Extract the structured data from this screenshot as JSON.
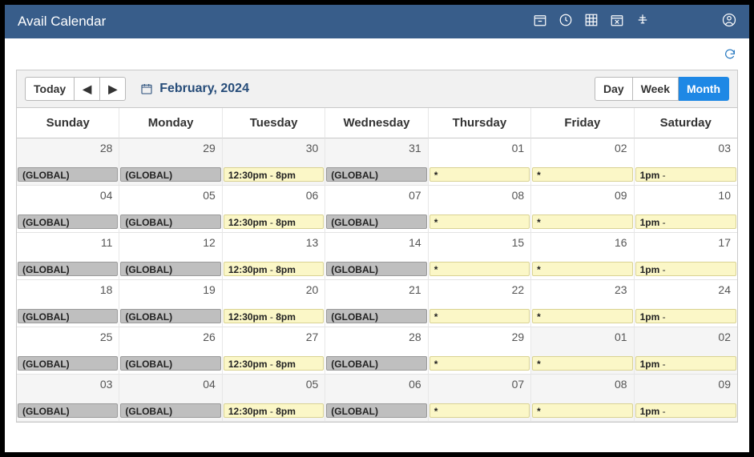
{
  "header": {
    "title": "Avail Calendar"
  },
  "toolbar": {
    "today": "Today",
    "prev": "◀",
    "next": "▶",
    "period": "February, 2024",
    "views": {
      "day": "Day",
      "week": "Week",
      "month": "Month",
      "active": "month"
    }
  },
  "day_names": [
    "Sunday",
    "Monday",
    "Tuesday",
    "Wednesday",
    "Thursday",
    "Friday",
    "Saturday"
  ],
  "events": {
    "global": "(GLOBAL)",
    "tuesday_from": "12:30pm",
    "tuesday_to": "8pm",
    "star": "*",
    "saturday_from": "1pm"
  },
  "weeks": [
    [
      {
        "num": "28",
        "out": true,
        "evt": "global"
      },
      {
        "num": "29",
        "out": true,
        "evt": "global"
      },
      {
        "num": "30",
        "out": true,
        "evt": "tuesday"
      },
      {
        "num": "31",
        "out": true,
        "evt": "global"
      },
      {
        "num": "01",
        "evt": "star"
      },
      {
        "num": "02",
        "evt": "star"
      },
      {
        "num": "03",
        "evt": "saturday"
      }
    ],
    [
      {
        "num": "04",
        "evt": "global"
      },
      {
        "num": "05",
        "evt": "global"
      },
      {
        "num": "06",
        "evt": "tuesday"
      },
      {
        "num": "07",
        "evt": "global"
      },
      {
        "num": "08",
        "evt": "star"
      },
      {
        "num": "09",
        "evt": "star"
      },
      {
        "num": "10",
        "evt": "saturday"
      }
    ],
    [
      {
        "num": "11",
        "evt": "global"
      },
      {
        "num": "12",
        "evt": "global"
      },
      {
        "num": "13",
        "evt": "tuesday"
      },
      {
        "num": "14",
        "evt": "global"
      },
      {
        "num": "15",
        "evt": "star"
      },
      {
        "num": "16",
        "evt": "star"
      },
      {
        "num": "17",
        "evt": "saturday"
      }
    ],
    [
      {
        "num": "18",
        "evt": "global"
      },
      {
        "num": "19",
        "evt": "global"
      },
      {
        "num": "20",
        "evt": "tuesday"
      },
      {
        "num": "21",
        "evt": "global"
      },
      {
        "num": "22",
        "evt": "star"
      },
      {
        "num": "23",
        "evt": "star"
      },
      {
        "num": "24",
        "evt": "saturday"
      }
    ],
    [
      {
        "num": "25",
        "evt": "global"
      },
      {
        "num": "26",
        "evt": "global"
      },
      {
        "num": "27",
        "evt": "tuesday"
      },
      {
        "num": "28",
        "evt": "global"
      },
      {
        "num": "29",
        "evt": "star"
      },
      {
        "num": "01",
        "out": true,
        "evt": "star"
      },
      {
        "num": "02",
        "out": true,
        "evt": "saturday"
      }
    ],
    [
      {
        "num": "03",
        "out": true,
        "evt": "global"
      },
      {
        "num": "04",
        "out": true,
        "evt": "global"
      },
      {
        "num": "05",
        "out": true,
        "evt": "tuesday"
      },
      {
        "num": "06",
        "out": true,
        "evt": "global"
      },
      {
        "num": "07",
        "out": true,
        "evt": "star"
      },
      {
        "num": "08",
        "out": true,
        "evt": "star"
      },
      {
        "num": "09",
        "out": true,
        "evt": "saturday"
      }
    ]
  ]
}
